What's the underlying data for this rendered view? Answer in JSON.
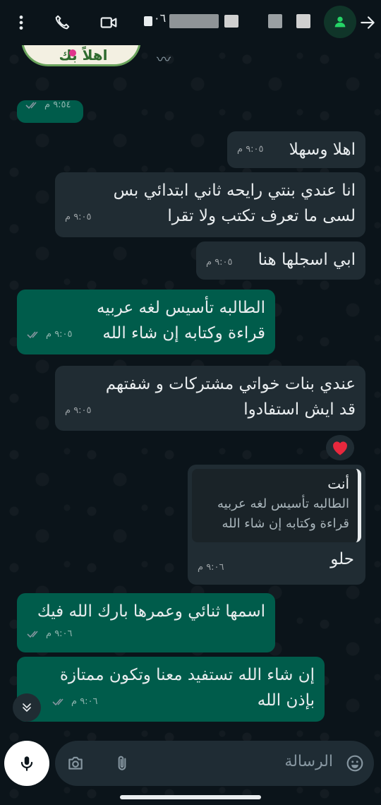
{
  "header": {
    "menu_icon": "vertical-dots-icon",
    "call_icon": "phone-icon",
    "video_icon": "video-camera-icon",
    "avatar_icon": "person-icon",
    "back_icon": "arrow-right-icon",
    "contact_name_fragment": "۰٦"
  },
  "sticker": {
    "text": "اهلاً بك"
  },
  "messages": [
    {
      "direction": "out",
      "text_lines": [
        ""
      ],
      "time": "٩:٥٤ م",
      "read": true
    },
    {
      "direction": "in",
      "text_lines": [
        "اهلا وسهلا"
      ],
      "time": "٩:٠٥ م"
    },
    {
      "direction": "in",
      "text_lines": [
        "انا عندي بنتي رايحه ثاني ابتدائي بس",
        "لسى ما تعرف تكتب ولا تقرا"
      ],
      "time": "٩:٠٥ م"
    },
    {
      "direction": "in",
      "text_lines": [
        "ابي اسجلها هنا"
      ],
      "time": "٩:٠٥ م"
    },
    {
      "direction": "out",
      "text_lines": [
        "الطالبه تأسيس لغه عربيه",
        "قراءة وكتابه إن شاء الله"
      ],
      "time": "٩:٠٥ م",
      "read": true
    },
    {
      "direction": "in",
      "text_lines": [
        "عندي بنات خواتي مشتركات و شفتهم",
        "قد ايش استفادوا"
      ],
      "time": "٩:٠٥ م"
    },
    {
      "direction": "in",
      "quote_author": "أنت",
      "quote_lines": [
        "الطالبه تأسيس لغه عربيه",
        "قراءة وكتابه إن شاء الله"
      ],
      "text_lines": [
        "حلو"
      ],
      "time": "٩:٠٦ م"
    },
    {
      "direction": "out",
      "text_lines": [
        "اسمها ثنائي وعمرها بارك الله فيك"
      ],
      "time": "٩:٠٦ م",
      "read": true
    },
    {
      "direction": "out",
      "text_lines": [
        "إن شاء الله تستفيد معنا وتكون ممتازة",
        "بإذن الله"
      ],
      "time": "٩:٠٦ م",
      "read": true
    }
  ],
  "reaction": {
    "emoji": "heart-icon",
    "color": "#e8283d"
  },
  "input": {
    "placeholder": "الرسالة",
    "emoji_icon": "emoji-icon",
    "attach_icon": "paperclip-icon",
    "camera_icon": "camera-icon",
    "mic_icon": "microphone-icon",
    "scroll_down_icon": "double-chevron-down-icon"
  },
  "colors": {
    "background": "#0b141a",
    "incoming": "#202c33",
    "outgoing": "#005c4b",
    "accent": "#25d366",
    "read_ticks": "#8696a0"
  }
}
